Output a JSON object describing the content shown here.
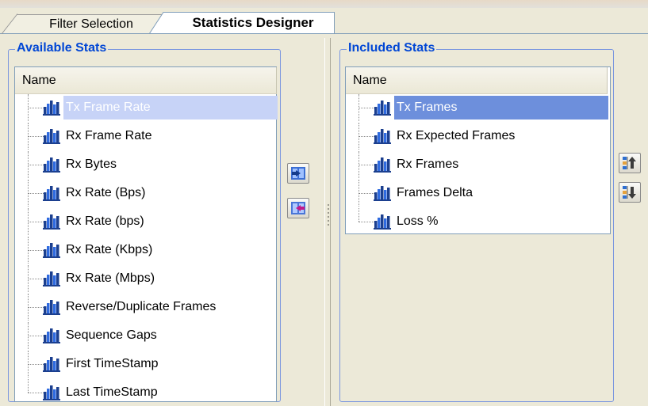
{
  "tabs": [
    {
      "label": "Filter Selection",
      "active": false
    },
    {
      "label": "Statistics Designer",
      "active": true
    }
  ],
  "available": {
    "legend": "Available Stats",
    "column_header": "Name",
    "items": [
      {
        "label": "Tx Frame Rate",
        "selected": true
      },
      {
        "label": "Rx Frame Rate"
      },
      {
        "label": "Rx Bytes"
      },
      {
        "label": "Rx Rate (Bps)"
      },
      {
        "label": "Rx Rate (bps)"
      },
      {
        "label": "Rx Rate (Kbps)"
      },
      {
        "label": "Rx Rate (Mbps)"
      },
      {
        "label": "Reverse/Duplicate Frames"
      },
      {
        "label": "Sequence Gaps"
      },
      {
        "label": "First TimeStamp"
      },
      {
        "label": "Last TimeStamp"
      }
    ]
  },
  "included": {
    "legend": "Included Stats",
    "column_header": "Name",
    "items": [
      {
        "label": "Tx Frames",
        "selected": true
      },
      {
        "label": "Rx Expected Frames"
      },
      {
        "label": "Rx Frames"
      },
      {
        "label": "Frames Delta"
      },
      {
        "label": "Loss %"
      }
    ]
  },
  "buttons": {
    "add": {
      "icon": "add-to-included-icon"
    },
    "remove": {
      "icon": "remove-from-included-icon"
    },
    "move_up": {
      "icon": "move-up-icon"
    },
    "move_down": {
      "icon": "move-down-icon"
    }
  },
  "colors": {
    "legend_text": "#0046d5",
    "selection_inactive": "#c7d3f7",
    "selection_active": "#6d8fdc",
    "group_border": "#7a96df"
  }
}
